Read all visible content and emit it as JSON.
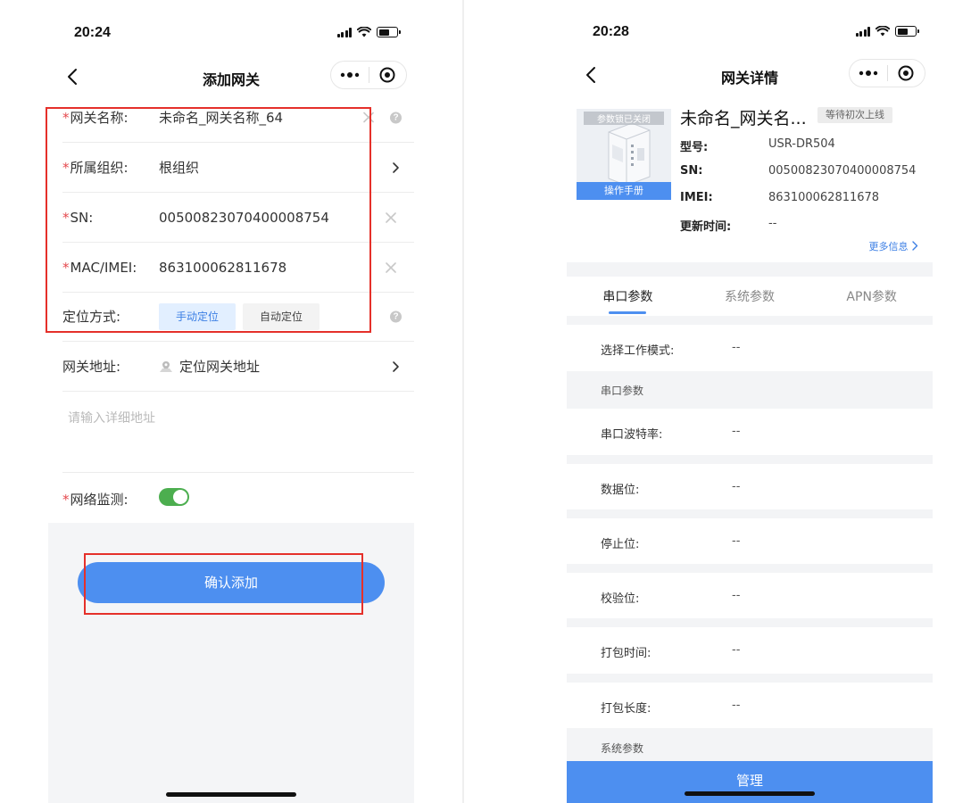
{
  "left": {
    "status_time": "20:24",
    "nav_title": "添加网关",
    "fields": [
      {
        "label": "网关名称:",
        "value": "未命名_网关名称_64",
        "required": true
      },
      {
        "label": "所属组织:",
        "value": "根组织",
        "required": true
      },
      {
        "label": "SN:",
        "value": "00500823070400008754",
        "required": true
      },
      {
        "label": "MAC/IMEI:",
        "value": "863100062811678",
        "required": true
      }
    ],
    "location_mode": {
      "label": "定位方式:",
      "option_manual": "手动定位",
      "option_auto": "自动定位",
      "selected": "手动定位"
    },
    "address": {
      "label": "网关地址:",
      "value": "定位网关地址"
    },
    "detail_placeholder": "请输入详细地址",
    "network_monitor": {
      "label": "网络监测:",
      "enabled": true
    },
    "confirm_button": "确认添加",
    "required_mark": "*",
    "help_mark": "?"
  },
  "right": {
    "status_time": "20:28",
    "nav_title": "网关详情",
    "image_top_label": "参数锁已关闭",
    "image_bottom_label": "操作手册",
    "device_name": "未命名_网关名...",
    "status_badge": "等待初次上线",
    "info": [
      {
        "key": "型号:",
        "value": "USR-DR504"
      },
      {
        "key": "SN:",
        "value": "00500823070400008754"
      },
      {
        "key": "IMEI:",
        "value": "863100062811678"
      },
      {
        "key": "更新时间:",
        "value": "--"
      }
    ],
    "more_info": "更多信息",
    "tabs": [
      {
        "label": "串口参数",
        "active": true
      },
      {
        "label": "系统参数",
        "active": false
      },
      {
        "label": "APN参数",
        "active": false
      }
    ],
    "work_mode": {
      "key": "选择工作模式:",
      "value": "--"
    },
    "section_serial": "串口参数",
    "serial_params": [
      {
        "key": "串口波特率:",
        "value": "--"
      },
      {
        "key": "数据位:",
        "value": "--"
      },
      {
        "key": "停止位:",
        "value": "--"
      },
      {
        "key": "校验位:",
        "value": "--"
      },
      {
        "key": "打包时间:",
        "value": "--"
      },
      {
        "key": "打包长度:",
        "value": "--"
      }
    ],
    "section_system": "系统参数",
    "manage_button": "管理"
  },
  "colors": {
    "accent": "#4d8ff0",
    "highlight_box": "#e5302a",
    "toggle_on": "#4cae4f",
    "required": "#e5484d"
  },
  "icons": [
    "back-chevron-icon",
    "more-dots-icon",
    "target-icon",
    "clear-icon",
    "help-icon",
    "chevron-right-icon",
    "location-pin-icon",
    "signal-icon",
    "wifi-icon",
    "battery-icon"
  ]
}
